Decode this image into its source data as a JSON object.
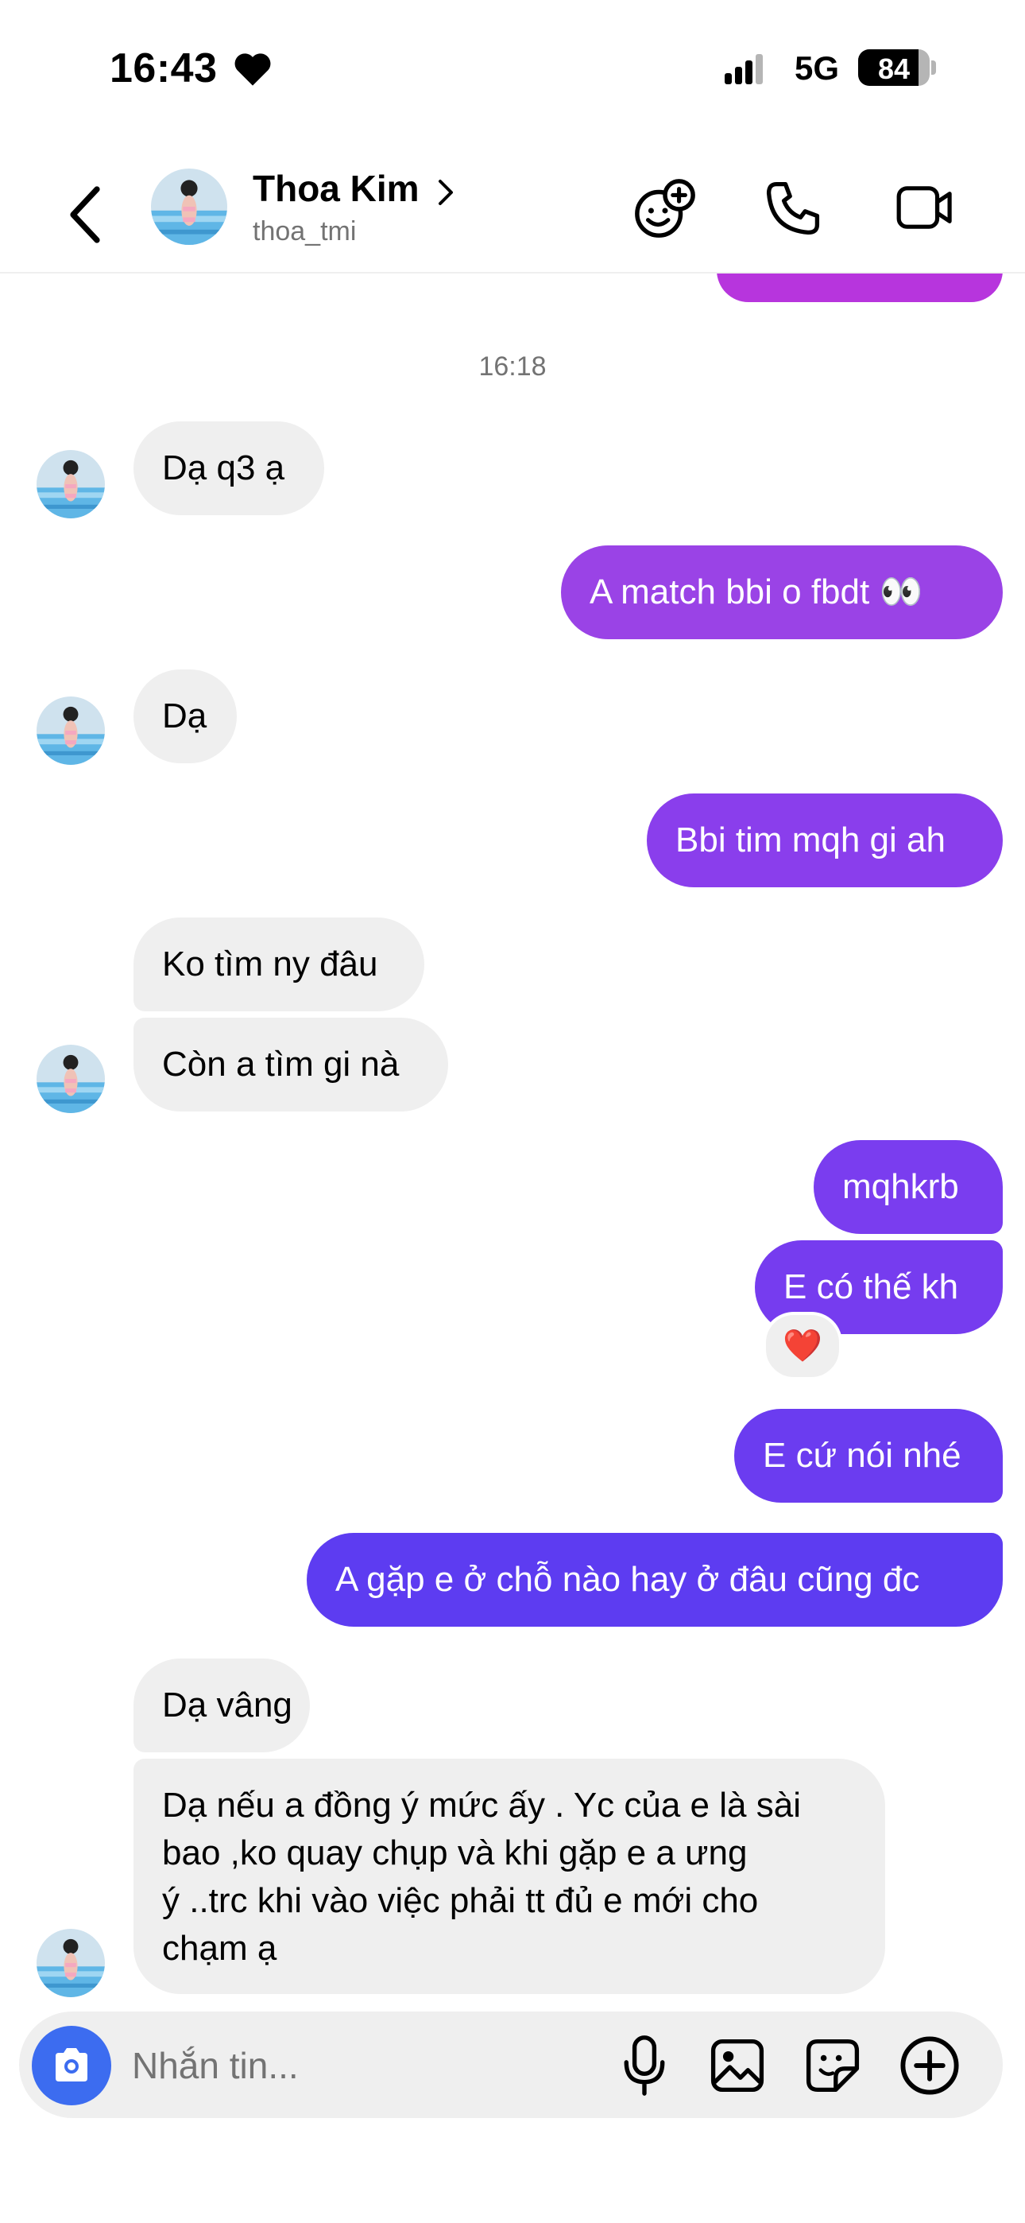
{
  "status_bar": {
    "time": "16:43",
    "network": "5G",
    "battery": "84",
    "battery_level": 0.84
  },
  "header": {
    "name": "Thoa Kim",
    "username": "thoa_tmi",
    "icons": [
      "back-arrow-icon",
      "chevron-right-icon",
      "effects-icon",
      "phone-icon",
      "video-camera-icon"
    ]
  },
  "chat": {
    "timestamp": "16:18",
    "messages": [
      {
        "dir": "in",
        "text": "Dạ q3 ạ"
      },
      {
        "dir": "out",
        "text": "A match bbi o fbdt 👀"
      },
      {
        "dir": "in",
        "text": "Dạ"
      },
      {
        "dir": "out",
        "text": "Bbi tim mqh gi ah"
      },
      {
        "dir": "in",
        "text": "Ko tìm ny đâu"
      },
      {
        "dir": "in",
        "text": "Còn a tìm gi nà"
      },
      {
        "dir": "out",
        "text": "mqhkrb"
      },
      {
        "dir": "out",
        "text": "E có thế kh",
        "reaction": "❤️"
      },
      {
        "dir": "out",
        "text": "E cứ nói nhé"
      },
      {
        "dir": "out",
        "text": "A gặp e ở chỗ nào hay ở đâu cũng đc"
      },
      {
        "dir": "in",
        "text": "Dạ vâng"
      },
      {
        "dir": "in",
        "lines": [
          "Dạ nếu a đồng ý mức ấy . Yc của e là sài",
          "bao ,ko quay chụp và khi gặp e a ưng",
          "ý ..trc khi vào việc phải tt đủ e mới cho",
          "chạm ạ"
        ]
      }
    ]
  },
  "composer": {
    "placeholder": "Nhắn tin...",
    "icons": [
      "camera-icon",
      "microphone-icon",
      "gallery-icon",
      "sticker-icon",
      "plus-circle-icon"
    ]
  },
  "colors": {
    "bubble_in": "#efefef",
    "bubble_out_top": "#a83fe0",
    "bubble_out_bottom": "#5b3bf0",
    "camera_button": "#3c6cf0",
    "meta_text": "#737373"
  }
}
